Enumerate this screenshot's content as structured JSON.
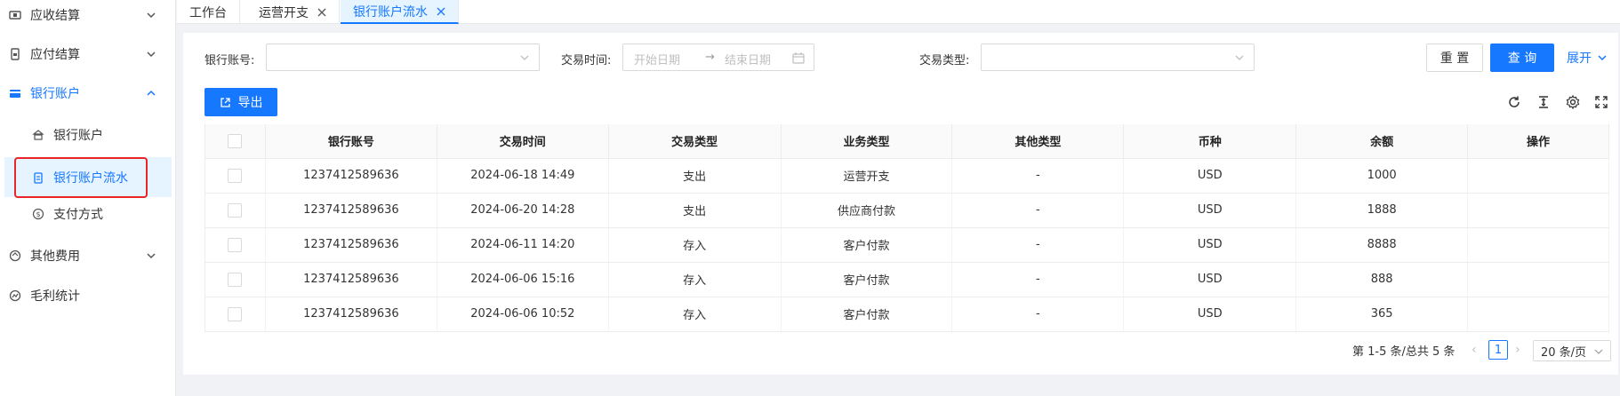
{
  "sidebar": {
    "items": [
      {
        "label": "应收结算",
        "icon": "receivable-icon"
      },
      {
        "label": "应付结算",
        "icon": "payable-icon"
      },
      {
        "label": "银行账户",
        "icon": "bank-account-icon"
      },
      {
        "label": "其他费用",
        "icon": "other-fees-icon"
      },
      {
        "label": "毛利统计",
        "icon": "gross-profit-icon"
      }
    ],
    "sub_items": [
      {
        "label": "银行账户",
        "icon": "bank-icon"
      },
      {
        "label": "银行账户流水",
        "icon": "statement-icon"
      },
      {
        "label": "支付方式",
        "icon": "payment-method-icon"
      }
    ]
  },
  "tabs": [
    {
      "label": "工作台"
    },
    {
      "label": "运营开支"
    },
    {
      "label": "银行账户流水"
    }
  ],
  "filters": {
    "bank_account_label": "银行账号:",
    "trade_time_label": "交易时间:",
    "start_placeholder": "开始日期",
    "end_placeholder": "结束日期",
    "trade_type_label": "交易类型:",
    "reset_label": "重 置",
    "search_label": "查 询",
    "expand_label": "展开"
  },
  "toolbar": {
    "export_label": "导出"
  },
  "table": {
    "columns": [
      "银行账号",
      "交易时间",
      "交易类型",
      "业务类型",
      "其他类型",
      "币种",
      "余额",
      "操作"
    ],
    "rows": [
      [
        "1237412589636",
        "2024-06-18 14:49",
        "支出",
        "运营开支",
        "-",
        "USD",
        "1000",
        ""
      ],
      [
        "1237412589636",
        "2024-06-20 14:28",
        "支出",
        "供应商付款",
        "-",
        "USD",
        "1888",
        ""
      ],
      [
        "1237412589636",
        "2024-06-11 14:20",
        "存入",
        "客户付款",
        "-",
        "USD",
        "8888",
        ""
      ],
      [
        "1237412589636",
        "2024-06-06 15:16",
        "存入",
        "客户付款",
        "-",
        "USD",
        "888",
        ""
      ],
      [
        "1237412589636",
        "2024-06-06 10:52",
        "存入",
        "客户付款",
        "-",
        "USD",
        "365",
        ""
      ]
    ]
  },
  "pagination": {
    "total_text": "第 1-5 条/总共 5 条",
    "current_page": "1",
    "page_size": "20 条/页"
  },
  "colors": {
    "accent": "#1677ff",
    "highlight_box": "#e8262a"
  }
}
